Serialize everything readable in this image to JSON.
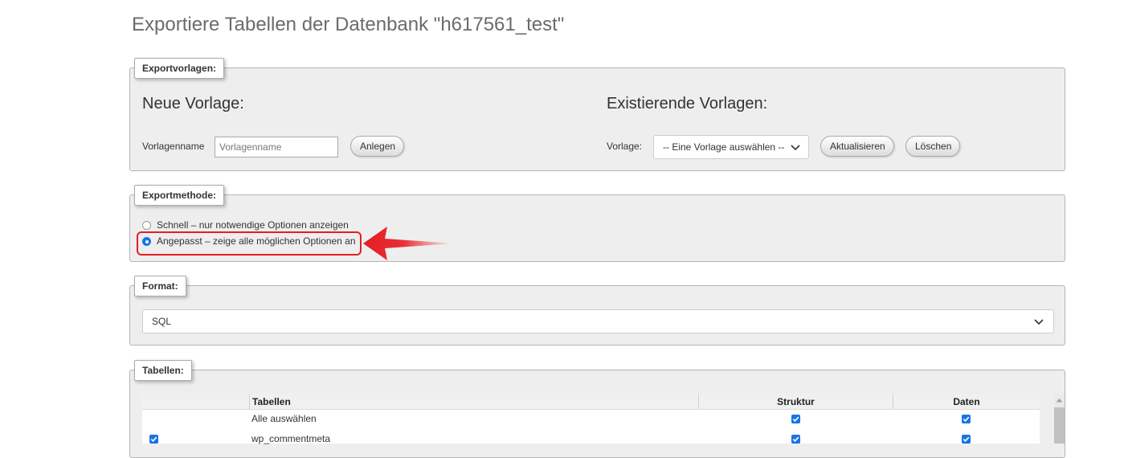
{
  "page_title": "Exportiere Tabellen der Datenbank \"h617561_test\"",
  "export_templates": {
    "legend": "Exportvorlagen:",
    "new_template": {
      "heading": "Neue Vorlage:",
      "name_label": "Vorlagenname",
      "name_placeholder": "Vorlagenname",
      "create_button": "Anlegen"
    },
    "existing_templates": {
      "heading": "Existierende Vorlagen:",
      "template_label": "Vorlage:",
      "template_select_value": "-- Eine Vorlage auswählen --",
      "update_button": "Aktualisieren",
      "delete_button": "Löschen"
    }
  },
  "export_method": {
    "legend": "Exportmethode:",
    "options": [
      {
        "label": "Schnell – nur notwendige Optionen anzeigen",
        "selected": false
      },
      {
        "label": "Angepasst – zeige alle möglichen Optionen an",
        "selected": true
      }
    ],
    "highlight_color": "#e31e24"
  },
  "format": {
    "legend": "Format:",
    "selected": "SQL"
  },
  "tables": {
    "legend": "Tabellen:",
    "columns": [
      "Tabellen",
      "Struktur",
      "Daten"
    ],
    "rows": [
      {
        "selected": null,
        "name": "Alle auswählen",
        "structure": true,
        "data": true
      },
      {
        "selected": true,
        "name": "wp_commentmeta",
        "structure": true,
        "data": true
      }
    ]
  },
  "accent_color": "#1a73e8"
}
